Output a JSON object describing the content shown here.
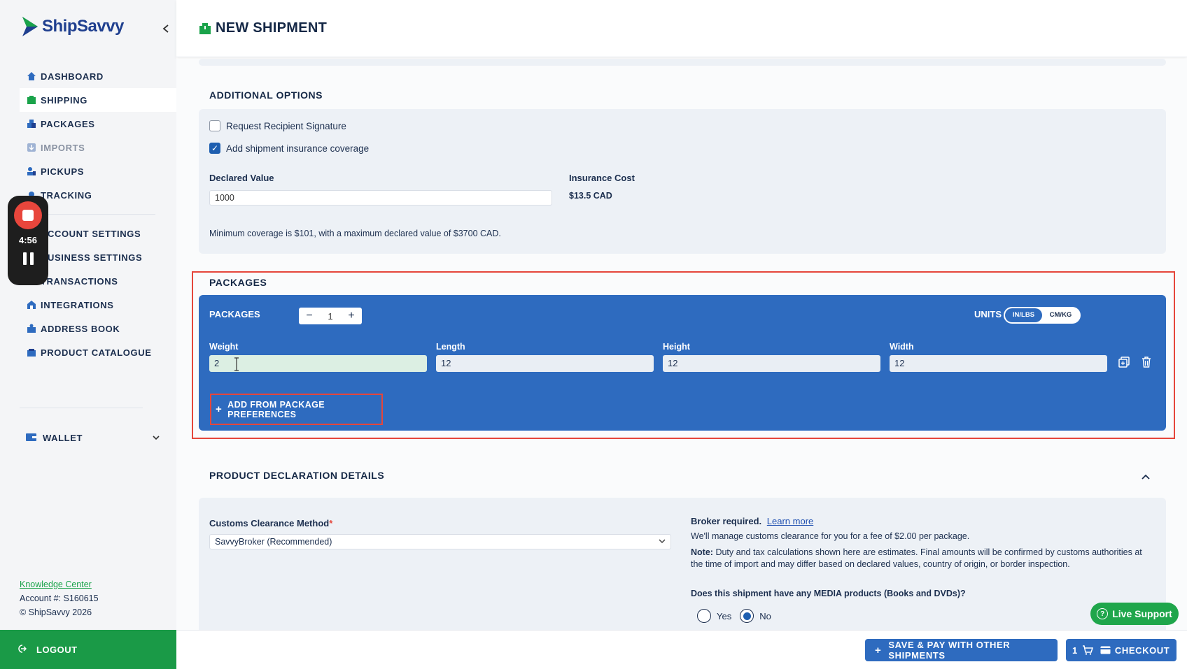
{
  "brand": {
    "name": "ShipSavvy"
  },
  "header": {
    "title": "NEW SHIPMENT"
  },
  "sidebar": {
    "items": [
      {
        "label": "DASHBOARD",
        "icon": "home-icon"
      },
      {
        "label": "SHIPPING",
        "icon": "shipping-box-icon",
        "active": true
      },
      {
        "label": "PACKAGES",
        "icon": "packages-icon"
      },
      {
        "label": "IMPORTS",
        "icon": "imports-icon"
      },
      {
        "label": "PICKUPS",
        "icon": "pickups-icon"
      },
      {
        "label": "TRACKING",
        "icon": "tracking-icon"
      },
      {
        "label": "ACCOUNT SETTINGS",
        "icon": "account-settings-icon"
      },
      {
        "label": "BUSINESS SETTINGS",
        "icon": "business-settings-icon"
      },
      {
        "label": "TRANSACTIONS",
        "icon": "transactions-icon"
      },
      {
        "label": "INTEGRATIONS",
        "icon": "integrations-icon"
      },
      {
        "label": "ADDRESS BOOK",
        "icon": "address-book-icon"
      },
      {
        "label": "PRODUCT CATALOGUE",
        "icon": "catalogue-icon"
      }
    ],
    "wallet": {
      "label": "WALLET"
    },
    "knowledge_center": "Knowledge Center",
    "account_number": "Account #: S160615",
    "copyright": "© ShipSavvy 2026",
    "logout": "LOGOUT"
  },
  "recorder": {
    "time": "4:56"
  },
  "additional_options": {
    "title": "ADDITIONAL OPTIONS",
    "signature_label": "Request Recipient Signature",
    "signature_checked": false,
    "insurance_label": "Add shipment insurance coverage",
    "insurance_checked": true,
    "declared_value_label": "Declared Value",
    "declared_value": "1000",
    "insurance_cost_label": "Insurance Cost",
    "insurance_cost": "$13.5 CAD",
    "coverage_note": "Minimum coverage is $101, with a maximum declared value of $3700 CAD."
  },
  "packages": {
    "title": "PACKAGES",
    "count_label": "PACKAGES",
    "count": "1",
    "units_label": "UNITS",
    "units_options": [
      "IN/LBS",
      "CM/KG"
    ],
    "units_selected": "IN/LBS",
    "fields": {
      "weight_label": "Weight",
      "weight": "2",
      "length_label": "Length",
      "length": "12",
      "height_label": "Height",
      "height": "12",
      "width_label": "Width",
      "width": "12"
    },
    "add_pref_label": "ADD FROM PACKAGE PREFERENCES"
  },
  "product_declaration": {
    "title": "PRODUCT DECLARATION DETAILS",
    "customs_label": "Customs Clearance Method",
    "required_mark": "*",
    "customs_value": "SavvyBroker (Recommended)",
    "broker_required": "Broker required.",
    "learn_more": "Learn more",
    "manage_text": "We'll manage customs clearance for you for a fee of $2.00 per package.",
    "note_label": "Note:",
    "note_text": "Duty and tax calculations shown here are estimates. Final amounts will be confirmed by customs authorities at the time of import and may differ based on declared values, country of origin, or border inspection.",
    "media_question": "Does this shipment have any MEDIA products (Books and DVDs)?",
    "yes_label": "Yes",
    "no_label": "No",
    "media_selected": "No"
  },
  "live_support": "Live Support",
  "footer_actions": {
    "save_pay": "SAVE & PAY WITH OTHER SHIPMENTS",
    "cart_count": "1",
    "checkout": "CHECKOUT"
  },
  "colors": {
    "brand_green": "#1a9a47",
    "brand_blue": "#2e6bbf",
    "highlight_red": "#e5463b"
  }
}
